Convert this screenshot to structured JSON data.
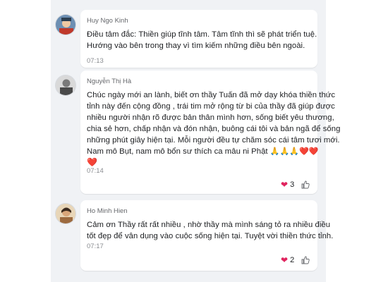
{
  "comments": [
    {
      "author": "Huy Ngo Kinh",
      "lines": [
        "Điều tâm đắc: Thiền giúp tĩnh tâm. Tâm tĩnh thì sẽ phát triển tuệ.",
        "Hướng vào bên trong thay vì tìm kiếm những điều bên ngoài."
      ],
      "time": "07:13"
    },
    {
      "author": "Nguyễn Thị Hà",
      "lines": [
        "Chúc ngày mới an lành, biết ơn thầy Tuấn đã mở dạy khóa thiền thức",
        "tỉnh này đến cộng đồng , trái tim mở rộng từ bi của thầy đã giúp được",
        "nhiều người nhận rõ được bản thân mình hơn, sống biết yêu thương,",
        "chia sẻ hơn, chấp nhận và đón nhận, buông cái tôi và bản ngã để sống",
        "những phút giây hiện tại. Mỗi người đều tự chăm sóc cái tâm tươi mới.",
        "Nam mô Bụt, nam mô bổn sư thích ca mâu ni Phật"
      ],
      "emoji_line": "🙏🙏🙏❤️❤️",
      "heart_line": "❤️",
      "time": "07:14",
      "reaction_count": "3"
    },
    {
      "author": "Ho Minh Hien",
      "lines": [
        "Cảm ơn Thầy rất rất nhiều , nhờ thầy mà mình sáng tỏ ra nhiều điều",
        "tốt đẹp để vân dụng vào cuộc sống hiện tại. Tuyệt vời thiền thức tỉnh."
      ],
      "time": "07:17",
      "reaction_count": "2"
    }
  ],
  "icons": {
    "heart": "heart-icon",
    "like": "like-icon"
  },
  "colors": {
    "background": "#f0f2f5",
    "heart": "#e0245e",
    "name": "#65676b"
  }
}
